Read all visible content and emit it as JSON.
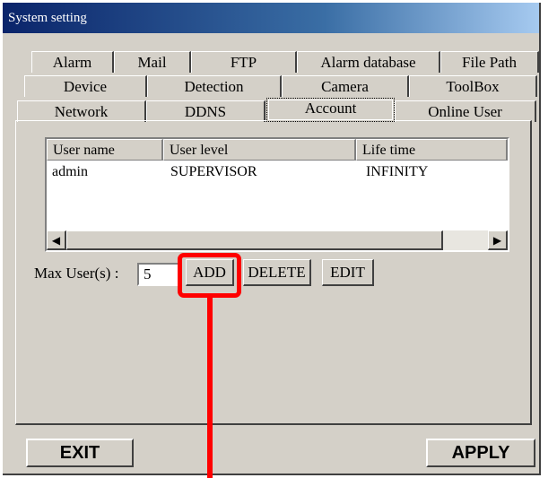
{
  "window": {
    "title": "System setting"
  },
  "tabs": {
    "row1": [
      "Alarm",
      "Mail",
      "FTP",
      "Alarm database",
      "File Path"
    ],
    "row2": [
      "Device",
      "Detection",
      "Camera",
      "ToolBox"
    ],
    "row3": [
      "Network",
      "DDNS",
      "Account",
      "Online User"
    ],
    "active": "Account"
  },
  "users_table": {
    "columns": [
      "User name",
      "User level",
      "Life time"
    ],
    "rows": [
      {
        "user_name": "admin",
        "user_level": "SUPERVISOR",
        "life_time": "INFINITY"
      }
    ]
  },
  "scrollbar": {
    "left_arrow": "◀",
    "right_arrow": "▶"
  },
  "max_users": {
    "label": "Max User(s) :",
    "value": "5"
  },
  "actions": {
    "add": "ADD",
    "delete": "DELETE",
    "edit": "EDIT"
  },
  "footer": {
    "exit": "EXIT",
    "apply": "APPLY"
  },
  "annotation_color": "#ff0000"
}
